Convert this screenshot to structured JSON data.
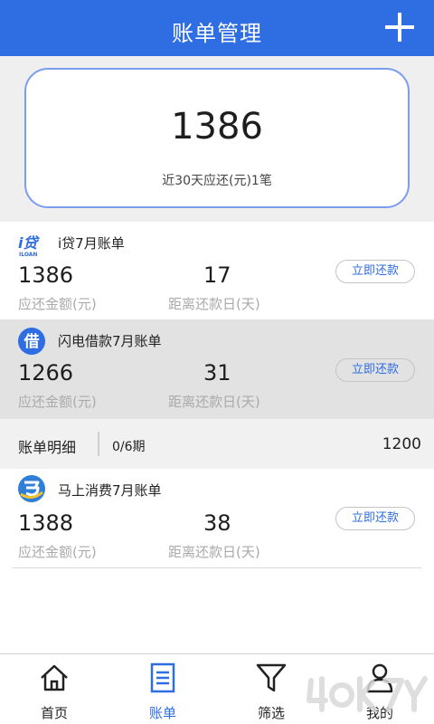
{
  "header": {
    "title": "账单管理",
    "add_icon": "plus-icon"
  },
  "summary": {
    "amount": "1386",
    "note": "近30天应还(元)1笔"
  },
  "bills": [
    {
      "logo_icon": "idai-logo-icon",
      "logo_text": "i贷",
      "logo_sub": "ILOAN",
      "title": "i贷7月账单",
      "amount": "1386",
      "amount_label": "应还金额(元)",
      "days": "17",
      "days_label": "距离还款日(天)",
      "pay_label": "立即还款"
    },
    {
      "logo_icon": "jie-logo-icon",
      "logo_text": "借",
      "title": "闪电借款7月账单",
      "amount": "1266",
      "amount_label": "应还金额(元)",
      "days": "31",
      "days_label": "距离还款日(天)",
      "pay_label": "立即还款"
    },
    {
      "logo_icon": "mashang-logo-icon",
      "title": "马上消费7月账单",
      "amount": "1388",
      "amount_label": "应还金额(元)",
      "days": "38",
      "days_label": "距离还款日(天)",
      "pay_label": "立即还款"
    }
  ],
  "detail": {
    "label": "账单明细",
    "periods": "0/6期",
    "amount": "1200"
  },
  "tabs": [
    {
      "label": "首页",
      "icon": "home-icon"
    },
    {
      "label": "账单",
      "icon": "bill-icon"
    },
    {
      "label": "筛选",
      "icon": "filter-icon"
    },
    {
      "label": "我的",
      "icon": "user-icon"
    }
  ],
  "colors": {
    "primary": "#2f6de2",
    "card_border": "#7b9df0",
    "selected_row": "#e2e2e2"
  }
}
